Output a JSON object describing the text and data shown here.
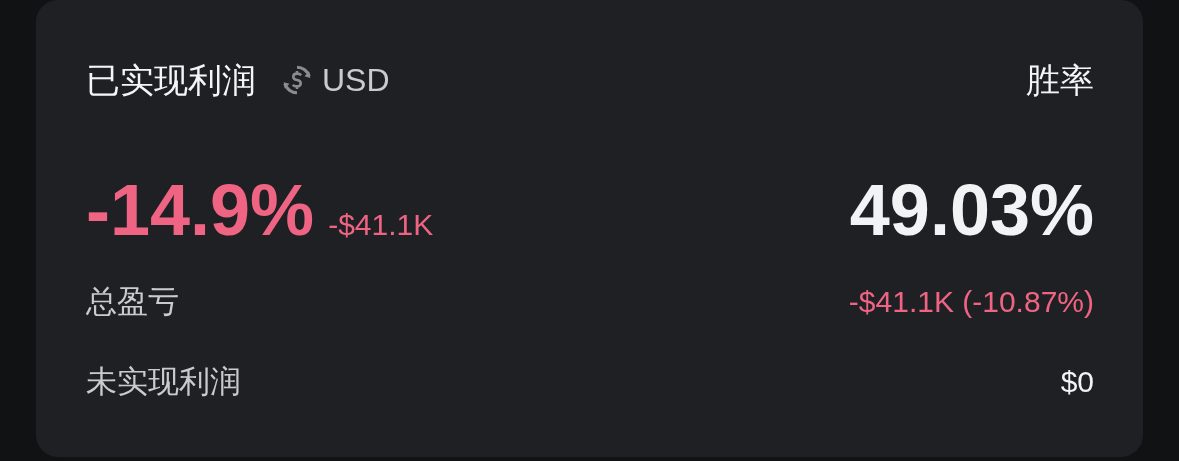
{
  "header": {
    "title": "已实现利润",
    "currency": "USD",
    "right_title": "胜率"
  },
  "main": {
    "value": {
      "text": "-14.9%",
      "color": "#ef6483"
    },
    "sub_value": {
      "text": "-$41.1K",
      "color": "#ef6483"
    },
    "right_value": {
      "text": "49.03%",
      "color": "#f1f3f4"
    }
  },
  "rows": [
    {
      "label": "总盈亏",
      "value": "-$41.1K (-10.87%)",
      "color": "#ef6483"
    },
    {
      "label": "未实现利润",
      "value": "$0",
      "color": "#f1f3f4"
    }
  ]
}
